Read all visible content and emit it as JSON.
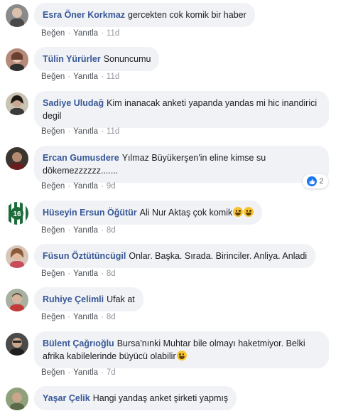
{
  "comments": [
    {
      "author": "Esra Öner Korkmaz",
      "text": "gercekten cok komik bir haber",
      "like": "Beğen",
      "reply": "Yanıtla",
      "time": "11d"
    },
    {
      "author": "Tülin Yürürler",
      "text": "Sonuncumu",
      "like": "Beğen",
      "reply": "Yanıtla",
      "time": "11d"
    },
    {
      "author": "Sadiye Uludağ",
      "text": "Kim inanacak anketi yapanda yandas mi hic inandirici degil",
      "like": "Beğen",
      "reply": "Yanıtla",
      "time": "11d"
    },
    {
      "author": "Ercan Gumusdere",
      "text": "Yılmaz Büyükerşen'in eline kimse su dökemezzzzzz.......",
      "like": "Beğen",
      "reply": "Yanıtla",
      "time": "9d",
      "reaction_count": "2",
      "reaction_icon": "like-icon"
    },
    {
      "author": "Hüseyin Ersun Öğütür",
      "text": "Ali Nur Aktaş çok komik",
      "like": "Beğen",
      "reply": "Yanıtla",
      "time": "8d",
      "emojis": [
        "grinning-face",
        "grinning-face"
      ]
    },
    {
      "author": "Füsun Öztütüncügil",
      "text": "Onlar. Başka. Sırada. Birinciler. Anliya. Anladi",
      "like": "Beğen",
      "reply": "Yanıtla",
      "time": "8d"
    },
    {
      "author": "Ruhiye Çelimli",
      "text": "Ufak at",
      "like": "Beğen",
      "reply": "Yanıtla",
      "time": "8d"
    },
    {
      "author": "Bülent Çağrıoğlu",
      "text": "Bursa'nınki Muhtar bile olmayı haketmiyor. Belki afrika kabilelerinde büyücü olabilir",
      "like": "Beğen",
      "reply": "Yanıtla",
      "time": "7d",
      "emojis": [
        "laughing-face"
      ]
    },
    {
      "author": "Yaşar Çelik",
      "text": "Hangi yandaş anket şirketi yapmış",
      "like": "",
      "reply": "",
      "time": ""
    }
  ],
  "colors": {
    "author": "#385898",
    "bubble": "#f0f2f5",
    "meta": "#90949c",
    "like_badge": "#1877f2"
  }
}
